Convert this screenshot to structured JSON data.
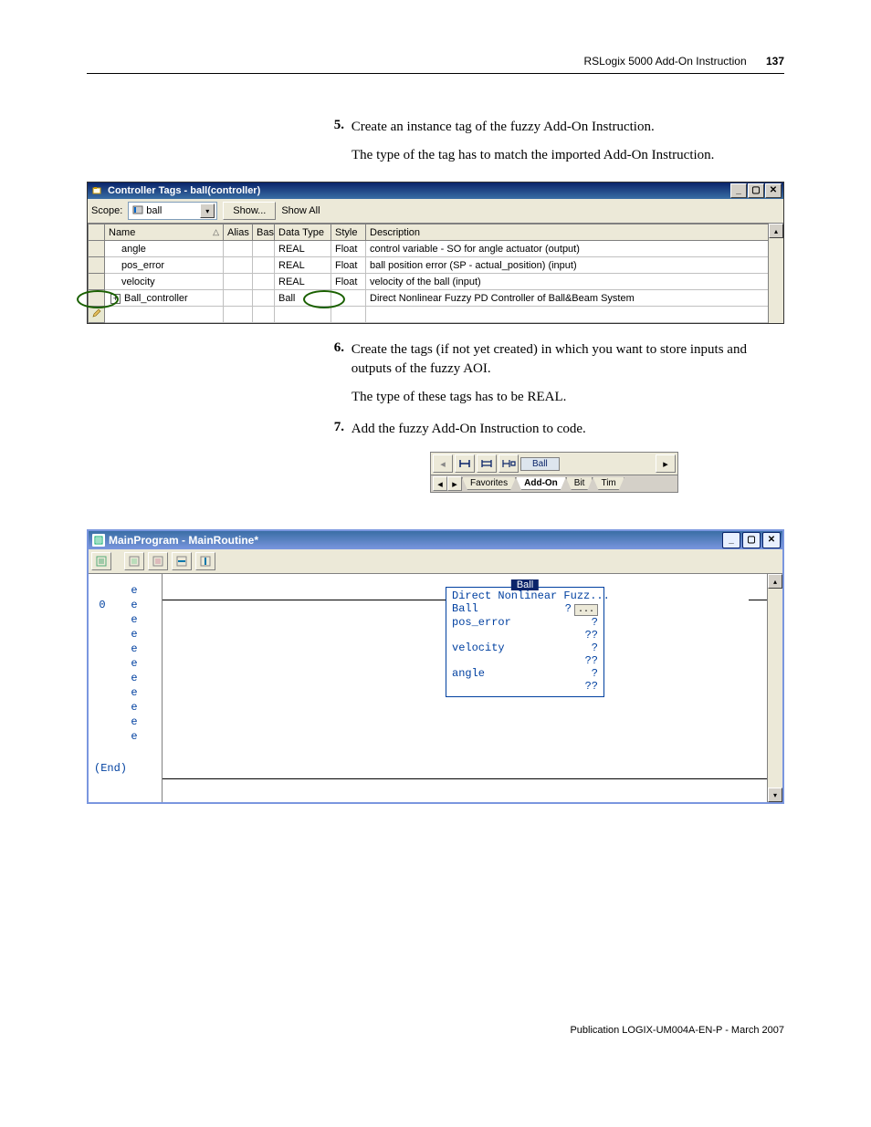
{
  "header": {
    "title": "RSLogix 5000 Add-On Instruction",
    "page_num": "137"
  },
  "steps": {
    "s5_num": "5.",
    "s5_text": "Create an instance tag of the fuzzy Add-On Instruction.",
    "s5_note": "The type of the tag has to match the imported Add-On Instruction.",
    "s6_num": "6.",
    "s6_text": "Create the tags (if not yet created) in which you want to store inputs and outputs of the fuzzy AOI.",
    "s6_note": "The type of these tags has to be REAL.",
    "s7_num": "7.",
    "s7_text": "Add the fuzzy Add-On Instruction to code."
  },
  "ct": {
    "title": "Controller Tags - ball(controller)",
    "scope_lbl": "Scope:",
    "scope_val": "ball",
    "show_btn": "Show...",
    "show_all": "Show All",
    "cols": {
      "name": "Name",
      "alias": "Alias",
      "base": "Bas",
      "dtype": "Data Type",
      "style": "Style",
      "desc": "Description"
    },
    "rows": [
      {
        "name": "angle",
        "dtype": "REAL",
        "style": "Float",
        "desc": "control variable - SO for angle actuator (output)"
      },
      {
        "name": "pos_error",
        "dtype": "REAL",
        "style": "Float",
        "desc": "ball position error (SP - actual_position) (input)"
      },
      {
        "name": "velocity",
        "dtype": "REAL",
        "style": "Float",
        "desc": "velocity of the ball (input)"
      },
      {
        "name": "Ball_controller",
        "dtype": "Ball",
        "style": "",
        "desc": "Direct Nonlinear Fuzzy PD Controller of Ball&Beam System"
      }
    ],
    "expand_prefix": "+"
  },
  "tabs": {
    "ball": "Ball",
    "favorites": "Favorites",
    "addon": "Add-On",
    "bit": "Bit",
    "time": "Tim"
  },
  "mp": {
    "title": "MainProgram - MainRoutine*",
    "rung0": "0",
    "e": "e",
    "end": "(End)",
    "block": {
      "title": "Ball",
      "sub": "Direct Nonlinear Fuzz...",
      "r1l": "Ball",
      "r1r": "?",
      "r2l": "pos_error",
      "r2r": "?",
      "r3r": "??",
      "r4l": "velocity",
      "r4r": "?",
      "r5r": "??",
      "r6l": "angle",
      "r6r": "?",
      "r7r": "??",
      "ell": "..."
    }
  },
  "footer": "Publication LOGIX-UM004A-EN-P - March 2007"
}
